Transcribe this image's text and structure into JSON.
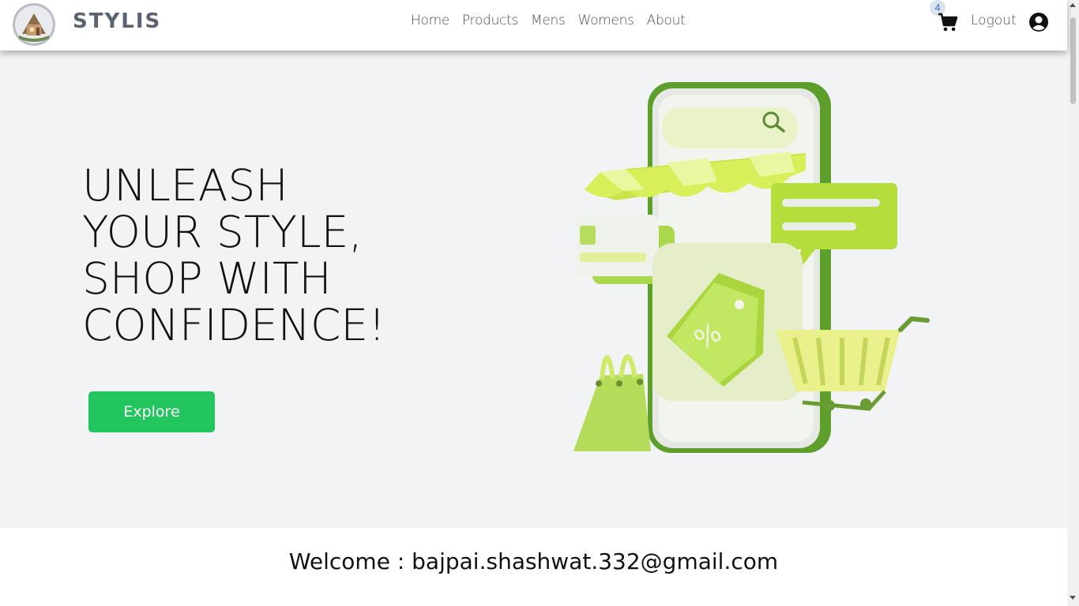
{
  "navbar": {
    "brand": "STYLIS",
    "links": [
      "Home",
      "Products",
      "Mens",
      "Womens",
      "About"
    ],
    "cart_count": "4",
    "logout_label": "Logout"
  },
  "hero": {
    "title_lines": [
      "UNLEASH",
      "YOUR STYLE,",
      "SHOP WITH",
      "CONFIDENCE!"
    ],
    "button_label": "Explore"
  },
  "welcome": {
    "text": "Welcome : bajpai.shashwat.332@gmail.com"
  },
  "colors": {
    "accent_green": "#22c55e",
    "hero_bg": "#f2f3f5",
    "brand_gray": "#5b6270"
  },
  "icons": [
    "logo-icon",
    "cart-icon",
    "user-circle-icon"
  ]
}
